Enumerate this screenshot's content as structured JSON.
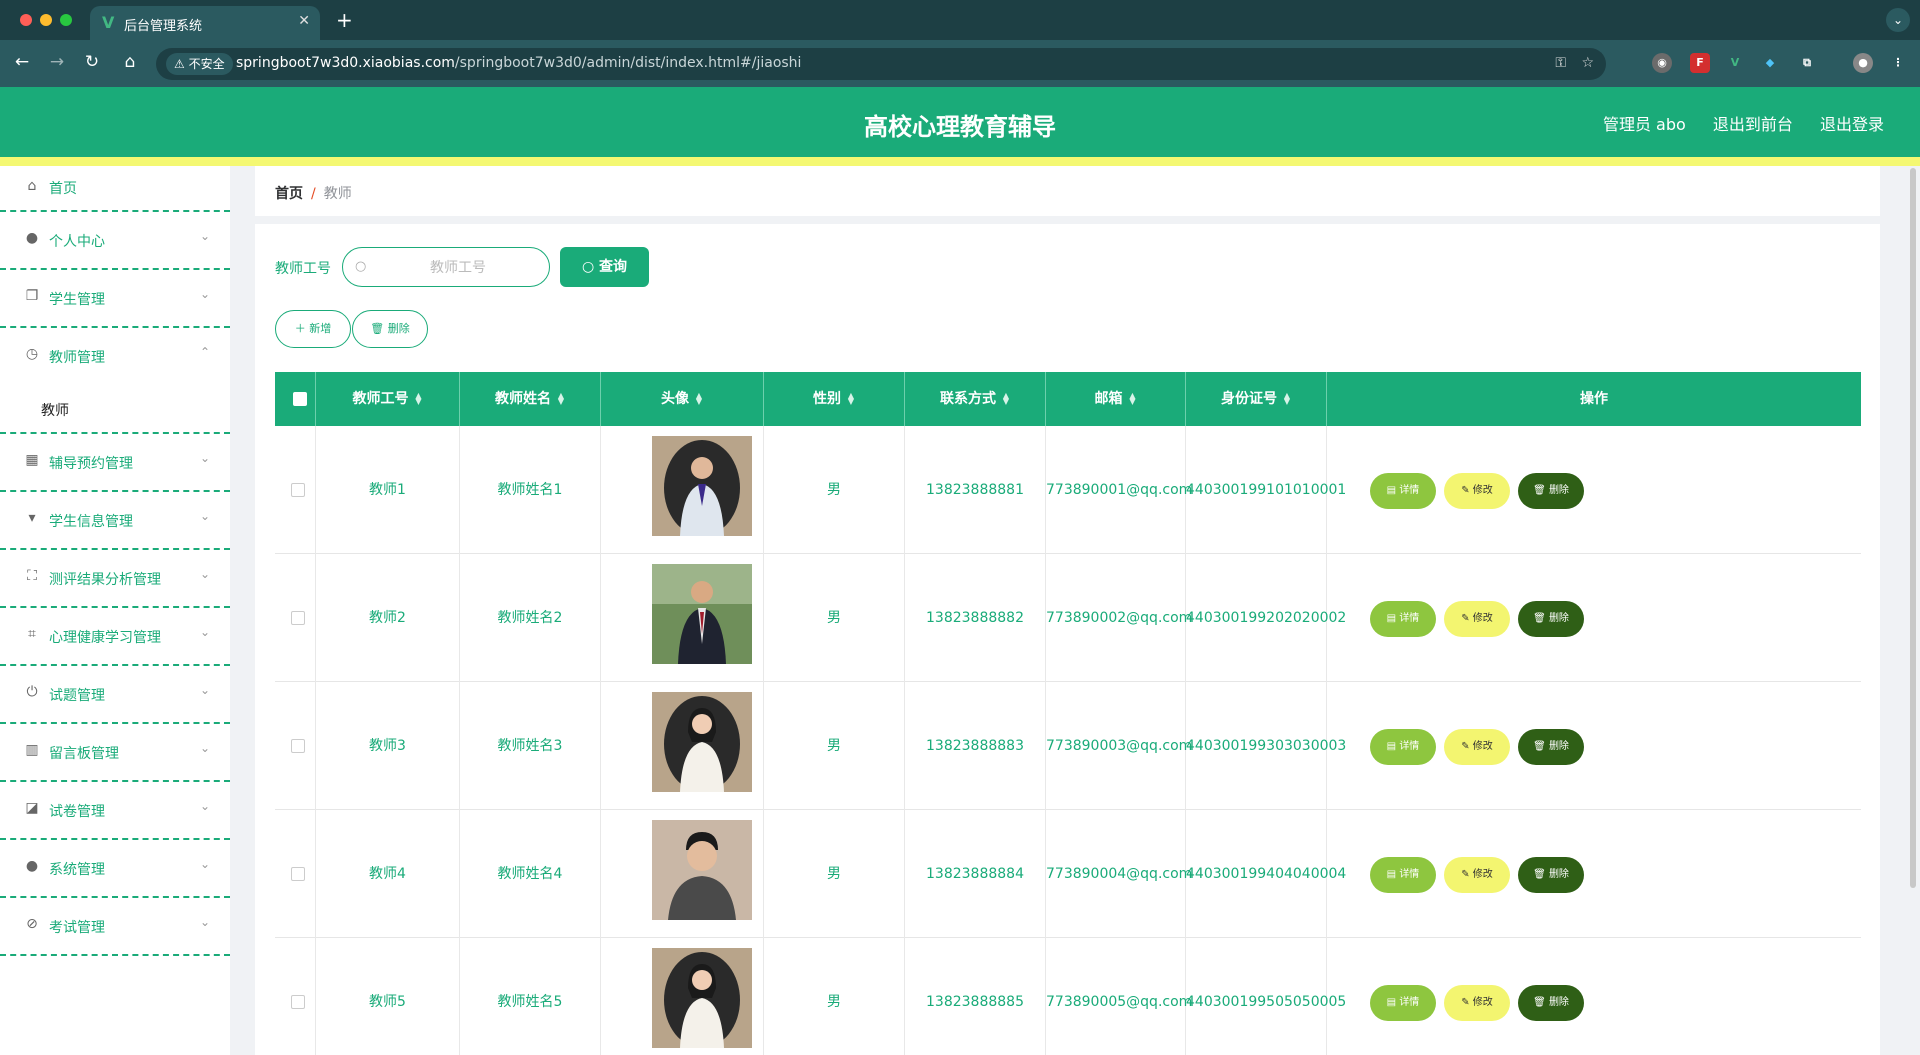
{
  "browser": {
    "tab_title": "后台管理系统",
    "tab_favicon": "V",
    "insecure_label": "不安全",
    "url_host": "springboot7w3d0.xiaobias.com",
    "url_path": "/springboot7w3d0/admin/dist/index.html#/jiaoshi"
  },
  "header": {
    "title": "高校心理教育辅导",
    "admin": "管理员 abo",
    "to_front": "退出到前台",
    "logout": "退出登录"
  },
  "sidebar": {
    "items": [
      {
        "label": "首页",
        "icon": "home-icon",
        "glyph": "⌂"
      },
      {
        "label": "个人中心",
        "icon": "user-icon",
        "glyph": "●"
      },
      {
        "label": "学生管理",
        "icon": "copy-icon",
        "glyph": "❐"
      },
      {
        "label": "教师管理",
        "icon": "clock-icon",
        "glyph": "◷"
      },
      {
        "label": "辅导预约管理",
        "icon": "grid-icon",
        "glyph": "▦"
      },
      {
        "label": "学生信息管理",
        "icon": "brush-icon",
        "glyph": "▾"
      },
      {
        "label": "测评结果分析管理",
        "icon": "fullscreen-icon",
        "glyph": "⛶"
      },
      {
        "label": "心理健康学习管理",
        "icon": "crop-icon",
        "glyph": "⌗"
      },
      {
        "label": "试题管理",
        "icon": "power-icon",
        "glyph": "⏻"
      },
      {
        "label": "留言板管理",
        "icon": "bar-chart-icon",
        "glyph": "▥"
      },
      {
        "label": "试卷管理",
        "icon": "line-chart-icon",
        "glyph": "◪"
      },
      {
        "label": "系统管理",
        "icon": "user-icon",
        "glyph": "●"
      },
      {
        "label": "考试管理",
        "icon": "bell-off-icon",
        "glyph": "⊘"
      }
    ],
    "submenu_label": "教师"
  },
  "breadcrumb": {
    "home": "首页",
    "separator": "/",
    "current": "教师"
  },
  "search": {
    "label": "教师工号",
    "placeholder": "教师工号",
    "button": "查询"
  },
  "actions": {
    "add": "＋ 新增",
    "delete": "删除"
  },
  "table": {
    "columns": [
      "教师工号",
      "教师姓名",
      "头像",
      "性别",
      "联系方式",
      "邮箱",
      "身份证号",
      "操作"
    ],
    "row_actions": {
      "detail": "详情",
      "edit": "修改",
      "delete": "删除"
    },
    "rows": [
      {
        "id": "教师1",
        "name": "教师姓名1",
        "gender": "男",
        "phone": "13823888881",
        "email": "773890001@qq.com",
        "idcard": "440300199101010001"
      },
      {
        "id": "教师2",
        "name": "教师姓名2",
        "gender": "男",
        "phone": "13823888882",
        "email": "773890002@qq.com",
        "idcard": "440300199202020002"
      },
      {
        "id": "教师3",
        "name": "教师姓名3",
        "gender": "男",
        "phone": "13823888883",
        "email": "773890003@qq.com",
        "idcard": "440300199303030003"
      },
      {
        "id": "教师4",
        "name": "教师姓名4",
        "gender": "男",
        "phone": "13823888884",
        "email": "773890004@qq.com",
        "idcard": "440300199404040004"
      },
      {
        "id": "教师5",
        "name": "教师姓名5",
        "gender": "男",
        "phone": "13823888885",
        "email": "773890005@qq.com",
        "idcard": "440300199505050005"
      }
    ]
  },
  "colors": {
    "primary": "#1aab79",
    "accent_yellow": "#f4f872",
    "detail_btn": "#8ec63f",
    "edit_btn": "#f3f570",
    "delete_btn": "#2f5f16"
  }
}
